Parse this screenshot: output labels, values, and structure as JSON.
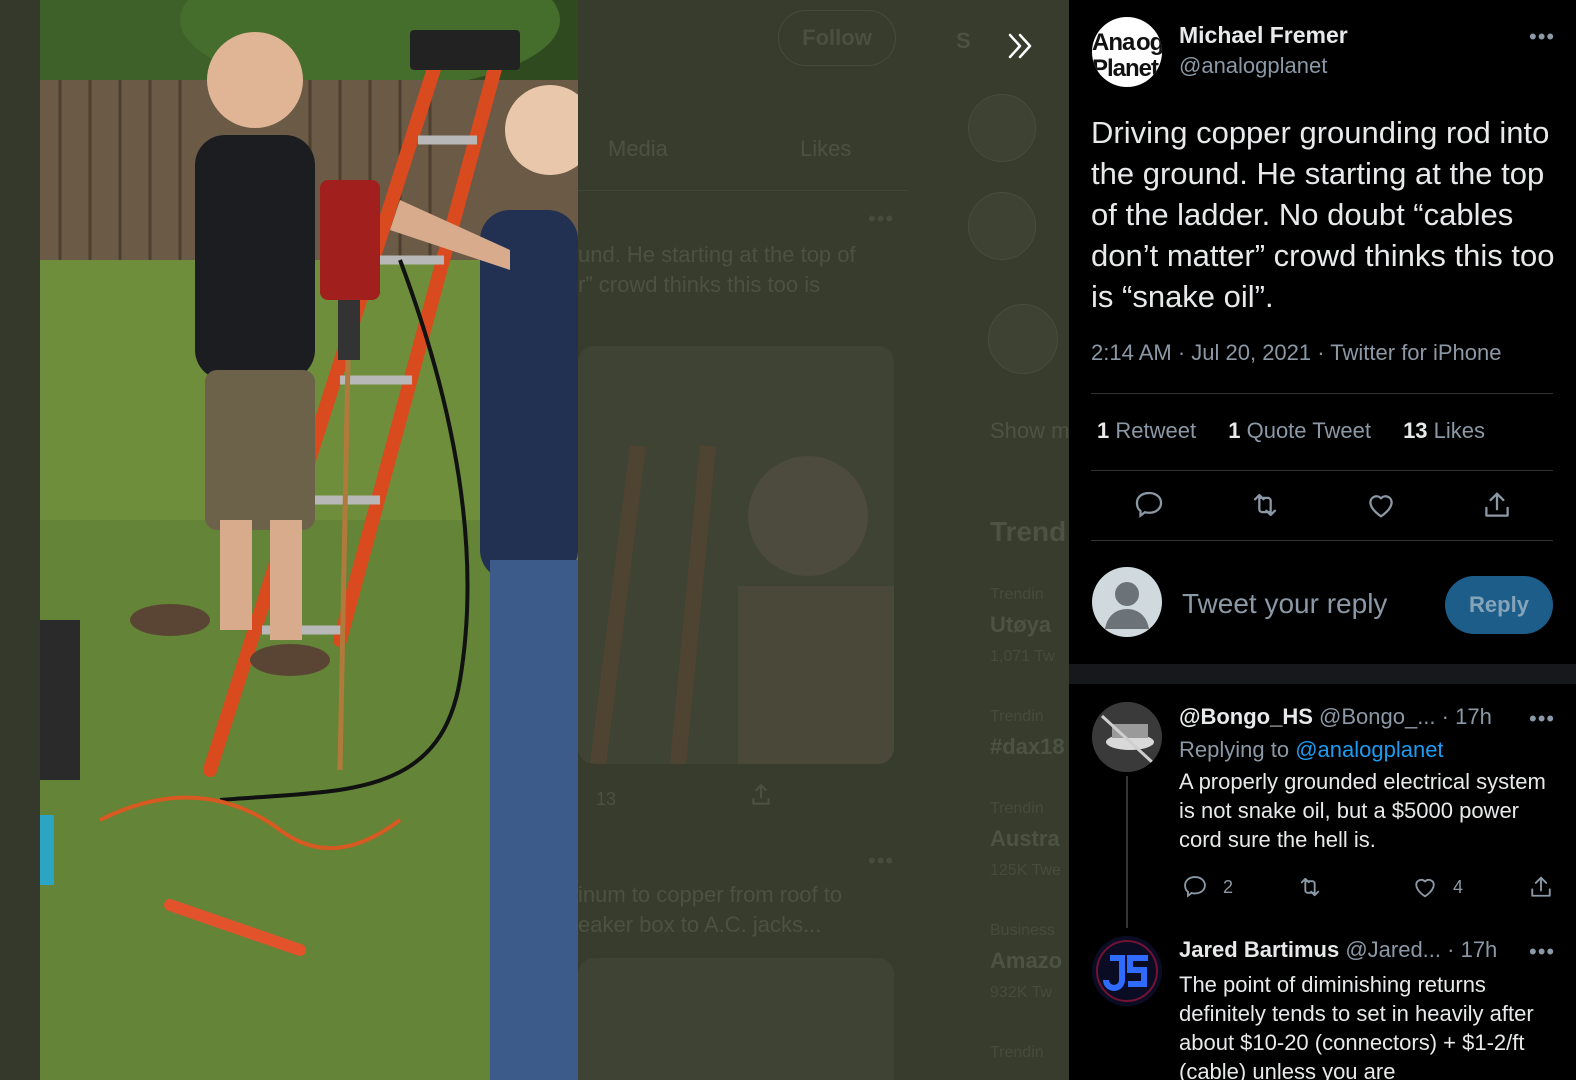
{
  "background": {
    "follow_label": "Follow",
    "tabs": [
      "Media",
      "Likes"
    ],
    "snippet_1": [
      "und. He starting at the top of",
      "r” crowd thinks this too is"
    ],
    "snippet_2": [
      "inum to copper from roof to",
      "eaker box to A.C. jacks..."
    ],
    "likes_count": "13",
    "sidebar": {
      "s_letter": "S",
      "show_more": "Show m",
      "trends_heading": "Trend",
      "trends": [
        {
          "small": "Trendin",
          "title": "Utøya",
          "count": "1,071 Tw"
        },
        {
          "small": "Trendin",
          "title": "#dax18",
          "count": ""
        },
        {
          "small": "Trendin",
          "title": "Austra",
          "count": "125K Twe"
        },
        {
          "small": "Business",
          "title": "Amazo",
          "count": "932K Tw"
        },
        {
          "small": "Trendin",
          "title": "",
          "count": ""
        }
      ]
    }
  },
  "tweet": {
    "author_name": "Michael Fremer",
    "author_handle": "@analogplanet",
    "avatar_text": [
      "Ana",
      "og",
      "Planet"
    ],
    "text": "Driving copper grounding rod into the ground. He starting at the top of the ladder. No doubt “cables don’t matter” crowd thinks this too is “snake oil”.",
    "meta": "2:14 AM · Jul 20, 2021 · Twitter for iPhone",
    "stats": {
      "retweets": "1",
      "retweets_label": "Retweet",
      "quotes": "1",
      "quotes_label": "Quote Tweet",
      "likes": "13",
      "likes_label": "Likes"
    },
    "actions": [
      "reply-icon",
      "retweet-icon",
      "like-icon",
      "share-icon"
    ]
  },
  "composer": {
    "placeholder": "Tweet your reply",
    "button": "Reply"
  },
  "replies": [
    {
      "name": "@Bongo_HS",
      "handle": "@Bongo_...",
      "time": "· 17h",
      "replying_prefix": "Replying to",
      "replying_to": "@analogplanet",
      "text": "A properly grounded electrical system is not snake oil, but a $5000 power cord sure the hell is.",
      "reply_count": "2",
      "retweet_count": "",
      "like_count": "4"
    },
    {
      "name": "Jared Bartimus",
      "handle": "@Jared...",
      "time": "· 17h",
      "text": "The point of diminishing returns definitely tends to set in heavily after about $10-20 (connectors) + $1-2/ft (cable) unless you are"
    }
  ],
  "colors": {
    "accent": "#1d9bf0",
    "pane_bg": "#000000",
    "muted_text": "#8b98a5",
    "overlay_bg": "#34392b"
  }
}
